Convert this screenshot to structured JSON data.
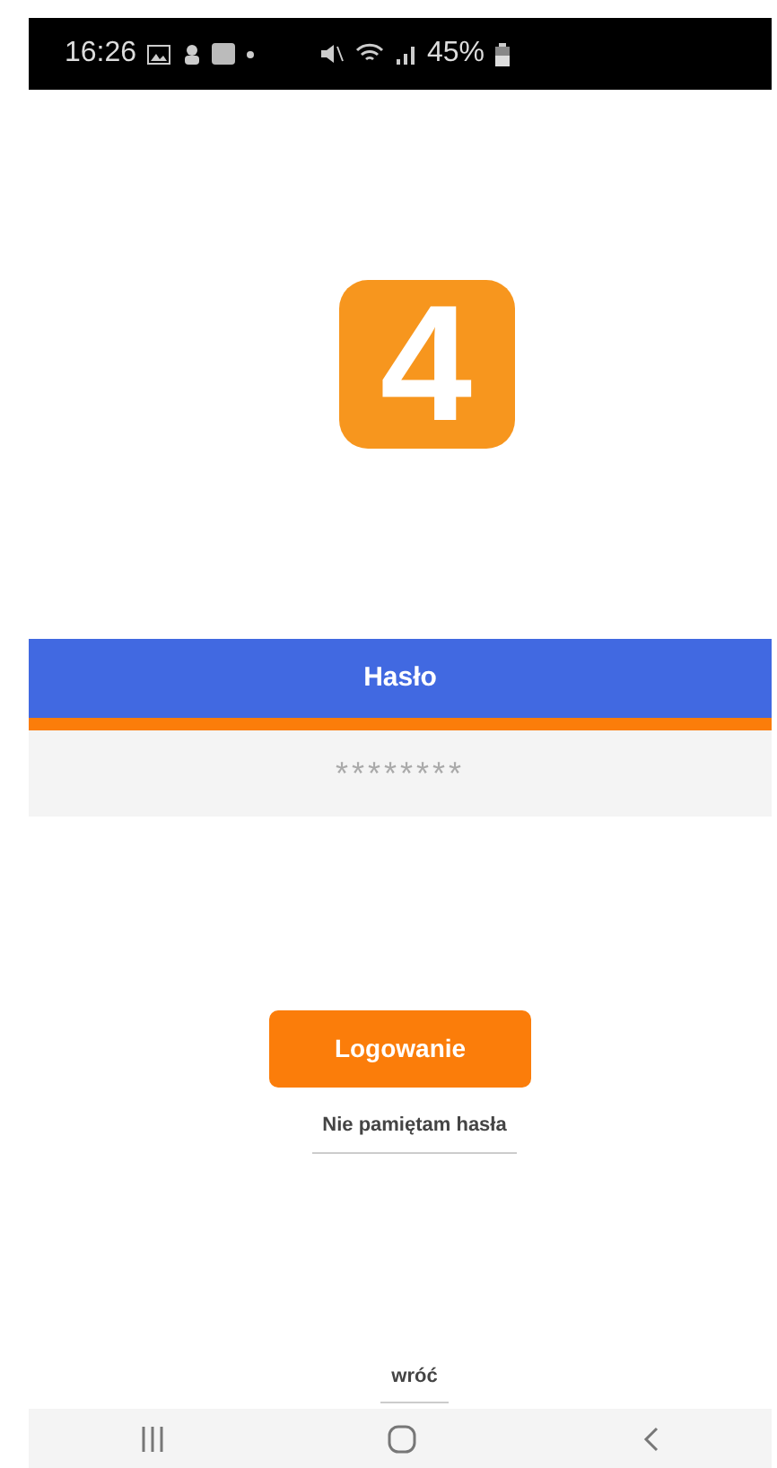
{
  "status_bar": {
    "time": "16:26",
    "battery": "45%"
  },
  "logo": {
    "text": "4"
  },
  "password": {
    "label": "Hasło",
    "placeholder": "********"
  },
  "login_button": "Logowanie",
  "forgot_link": "Nie pamiętam hasła",
  "back_link": "wróć"
}
